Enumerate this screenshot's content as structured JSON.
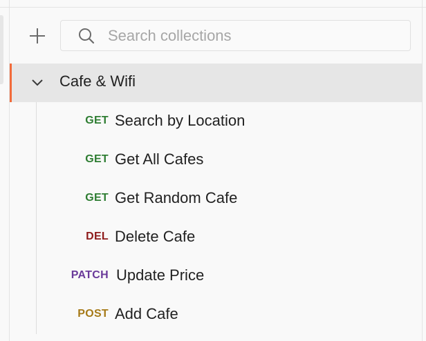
{
  "sidebar": {
    "search": {
      "placeholder": "Search collections",
      "value": ""
    },
    "collection": {
      "name": "Cafe & Wifi",
      "expanded": true,
      "accent_color": "#f26b3a"
    },
    "requests": [
      {
        "method": "GET",
        "name": "Search by Location",
        "color": "#2e7d32"
      },
      {
        "method": "GET",
        "name": "Get All Cafes",
        "color": "#2e7d32"
      },
      {
        "method": "GET",
        "name": "Get Random Cafe",
        "color": "#2e7d32"
      },
      {
        "method": "DEL",
        "name": "Delete Cafe",
        "color": "#8e1b1b"
      },
      {
        "method": "PATCH",
        "name": "Update Price",
        "color": "#6a3a9a"
      },
      {
        "method": "POST",
        "name": "Add Cafe",
        "color": "#a67a18"
      }
    ]
  }
}
